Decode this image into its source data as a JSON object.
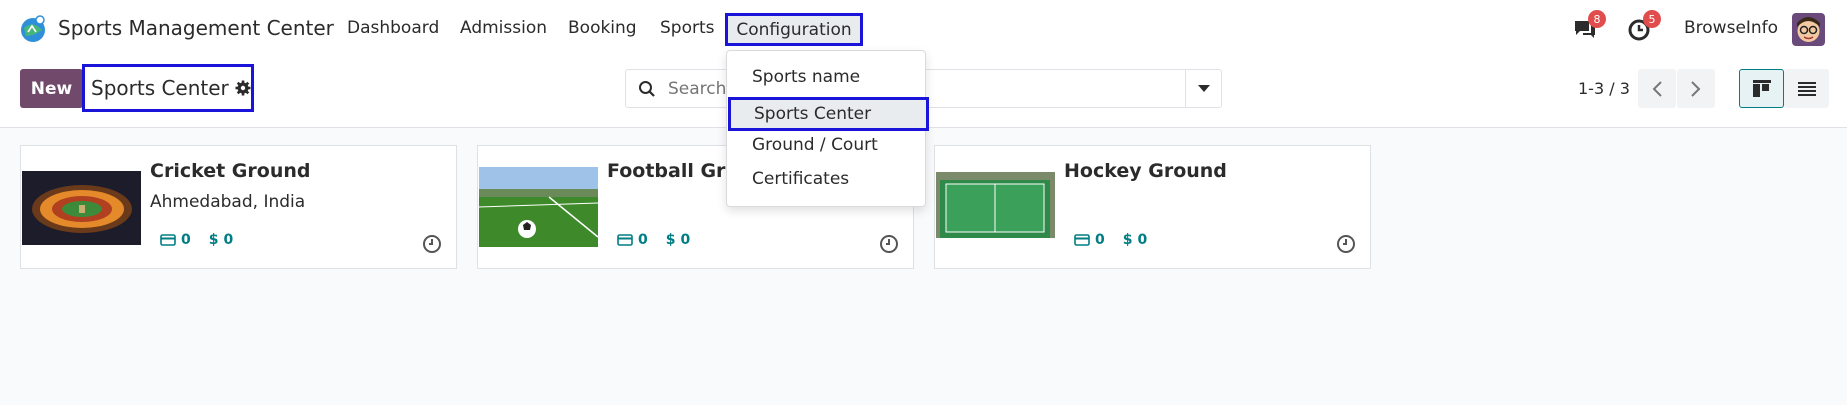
{
  "app": {
    "name": "Sports Management Center"
  },
  "nav": {
    "menus": [
      "Dashboard",
      "Admission",
      "Booking",
      "Sports",
      "Configuration"
    ],
    "messages_badge": "8",
    "activity_badge": "5",
    "user": "BrowseInfo"
  },
  "control": {
    "new_label": "New",
    "breadcrumb": "Sports Center",
    "search_placeholder": "Search...",
    "pager": "1-3 / 3"
  },
  "dropdown": {
    "items": [
      "Sports name",
      "Sports Center",
      "Ground / Court",
      "Certificates"
    ],
    "active": "Sports Center"
  },
  "cards": [
    {
      "title": "Cricket Ground",
      "subtitle": "Ahmedabad, India",
      "count": "0",
      "amount": "0"
    },
    {
      "title": "Football Ground",
      "subtitle": "",
      "count": "0",
      "amount": "0"
    },
    {
      "title": "Hockey Ground",
      "subtitle": "",
      "count": "0",
      "amount": "0"
    }
  ],
  "colors": {
    "brand": "#71496b",
    "accent": "#017e84",
    "highlight": "#1a14d9",
    "badge": "#e14d4d"
  },
  "icons": [
    "app-logo-icon",
    "chat-icon",
    "clock-icon",
    "search-icon",
    "caret-down-icon",
    "chevron-left-icon",
    "chevron-right-icon",
    "kanban-icon",
    "list-icon",
    "gear-icon",
    "card-icon",
    "dollar-icon"
  ]
}
